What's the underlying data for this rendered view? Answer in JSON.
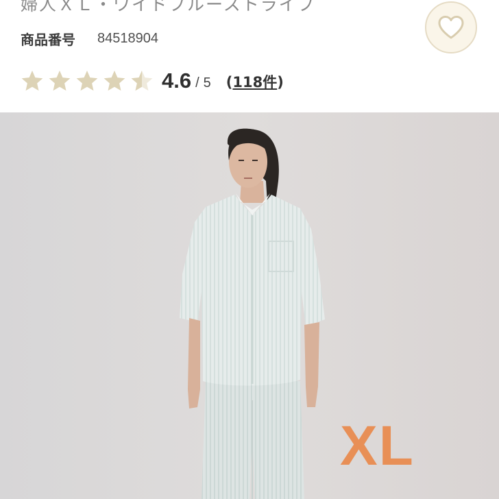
{
  "product": {
    "title_partial": "婦人ＸＬ・ワイドブルーストライプ",
    "code_label": "商品番号",
    "code_value": "84518904"
  },
  "rating": {
    "stars_value": 4.5,
    "stars_max": 5,
    "score": "4.6",
    "separator": "/",
    "max": "5",
    "review_open": "(",
    "review_count": "118件",
    "review_close": ")"
  },
  "favorite": {
    "icon": "heart-icon"
  },
  "photo": {
    "size_tag": "XL"
  },
  "colors": {
    "star_color": "#ddd3b6",
    "size_tag_color": "#e88f56",
    "favorite_bg": "#faf5e9"
  }
}
